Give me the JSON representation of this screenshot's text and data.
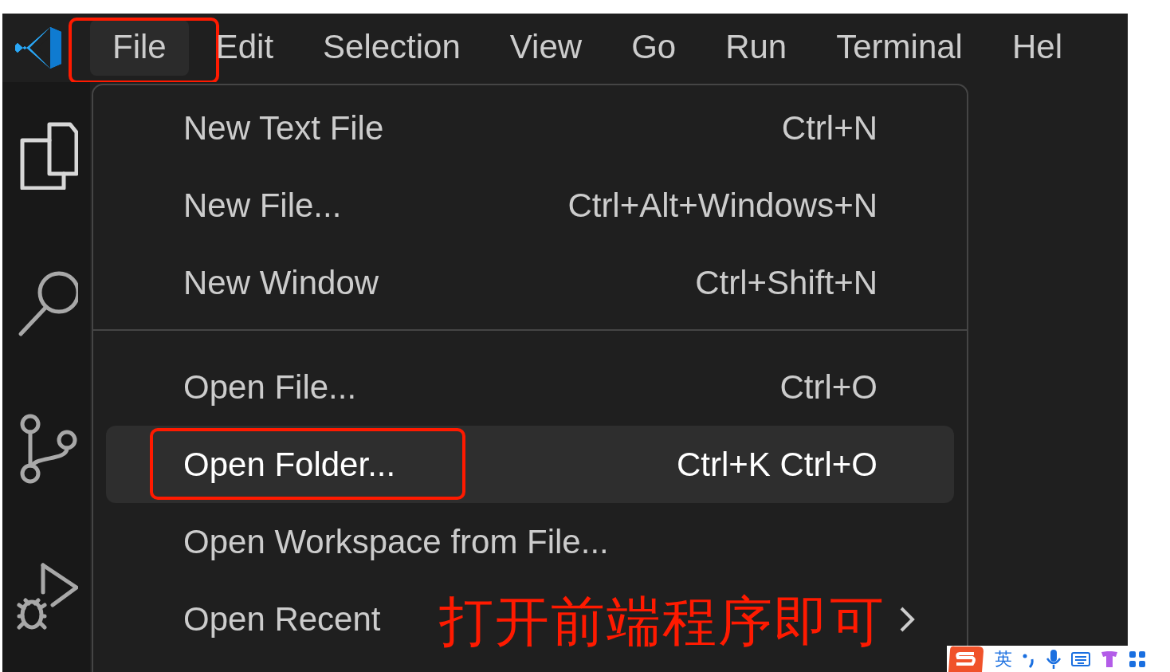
{
  "menu_bar": {
    "items": [
      {
        "label": "File",
        "selected": true,
        "annotated": true
      },
      {
        "label": "Edit",
        "selected": false,
        "annotated": false
      },
      {
        "label": "Selection",
        "selected": false,
        "annotated": false
      },
      {
        "label": "View",
        "selected": false,
        "annotated": false
      },
      {
        "label": "Go",
        "selected": false,
        "annotated": false
      },
      {
        "label": "Run",
        "selected": false,
        "annotated": false
      },
      {
        "label": "Terminal",
        "selected": false,
        "annotated": false
      },
      {
        "label": "Hel",
        "selected": false,
        "annotated": false
      }
    ]
  },
  "file_menu": {
    "sections": [
      {
        "items": [
          {
            "label": "New Text File",
            "shortcut": "Ctrl+N",
            "selected": false,
            "annotated": false,
            "kind": "command"
          },
          {
            "label": "New File...",
            "shortcut": "Ctrl+Alt+Windows+N",
            "selected": false,
            "annotated": false,
            "kind": "command"
          },
          {
            "label": "New Window",
            "shortcut": "Ctrl+Shift+N",
            "selected": false,
            "annotated": false,
            "kind": "command"
          }
        ]
      },
      {
        "items": [
          {
            "label": "Open File...",
            "shortcut": "Ctrl+O",
            "selected": false,
            "annotated": false,
            "kind": "command"
          },
          {
            "label": "Open Folder...",
            "shortcut": "Ctrl+K Ctrl+O",
            "selected": true,
            "annotated": true,
            "kind": "command"
          },
          {
            "label": "Open Workspace from File...",
            "selected": false,
            "annotated": false,
            "kind": "command"
          },
          {
            "label": "Open Recent",
            "selected": false,
            "annotated": false,
            "kind": "submenu"
          }
        ]
      }
    ]
  },
  "annotation": {
    "text": "打开前端程序即可"
  },
  "ime_bar": {
    "mode": "英"
  }
}
